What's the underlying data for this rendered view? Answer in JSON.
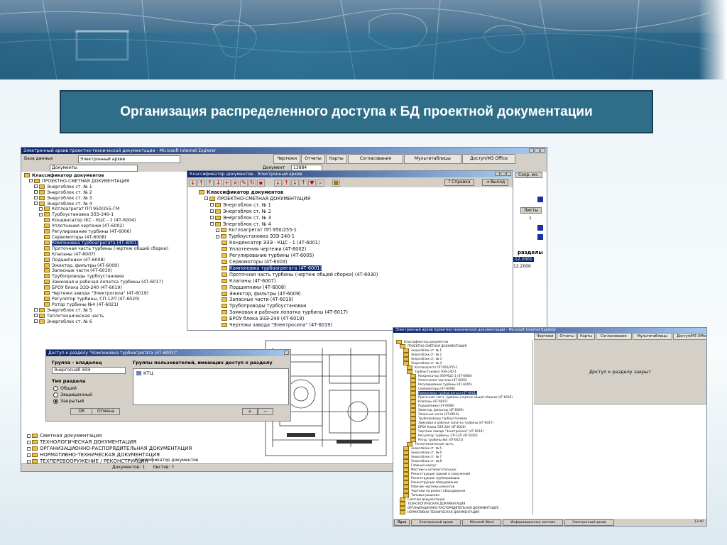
{
  "slide": {
    "title": "Организация распределенного доступа к БД проектной документации"
  },
  "win1": {
    "title": "Электронный архив проектно-технической документации - Microsoft Internet Explorer",
    "base_label": "База данных",
    "base_value": "Электронный архив",
    "tabs": [
      "Чертежи",
      "Отчеты",
      "Карты",
      "Согласования",
      "Мультитаблицы",
      "Доступ/МЗ Office"
    ],
    "doc_label": "Документ",
    "doc_value": "Документы",
    "doc_num": "13884",
    "tree_root": "Классификатор документов",
    "tree": [
      {
        "t": "ПРОЕКТНО-СМЕТНАЯ ДОКУМЕНТАЦИЯ",
        "l": 1
      },
      {
        "t": "Энергоблок ст. № 1",
        "l": 2
      },
      {
        "t": "Энергоблок ст. № 2",
        "l": 2
      },
      {
        "t": "Энергоблок ст. № 3",
        "l": 2
      },
      {
        "t": "Энергоблок ст. № 4",
        "l": 2
      },
      {
        "t": "Котлоагрегат ПП 950/255-ГМ",
        "l": 3
      },
      {
        "t": "Турбоустановка ЭЗЭ-240-1",
        "l": 3
      },
      {
        "t": "Конденсатор (КС - КЦС - 1 (4Т-6004)",
        "l": 4
      },
      {
        "t": "Уплотнения чертежи (4Т-6002)",
        "l": 4
      },
      {
        "t": "Регулирование турбины (4Т-6006)",
        "l": 4
      },
      {
        "t": "Сервомоторы (4Т-6008)",
        "l": 4
      },
      {
        "t": "Компоновка турбоагрегата (4Т-6001)",
        "l": 4,
        "sel": true
      },
      {
        "t": "Проточная часть турбины (чертеж общий сборки)",
        "l": 4
      },
      {
        "t": "Клапаны (4Т-6007)",
        "l": 4
      },
      {
        "t": "Подшипники (4Т-6008)",
        "l": 4
      },
      {
        "t": "Эжектор, фильтры (4Т-6009)",
        "l": 4
      },
      {
        "t": "Запасные части (4Т-6010)",
        "l": 4
      },
      {
        "t": "Трубопроводы турбоустановки",
        "l": 4
      },
      {
        "t": "Замковая и рабочая лопатка турбины (4Т-6017)",
        "l": 4
      },
      {
        "t": "БРОУ блока ЭЗЭ-240 (4Т-6019)",
        "l": 4
      },
      {
        "t": "Чертежи завода \"Электросила\" (4Т-6019)",
        "l": 4
      },
      {
        "t": "Регулятор турбины, СП-12П (4Т-6020)",
        "l": 4
      },
      {
        "t": "Ротор турбины №4 (4Т-6021)",
        "l": 4
      },
      {
        "t": "Энергоблок ст. № 5",
        "l": 2
      },
      {
        "t": "Теплотехническая часть",
        "l": 2
      },
      {
        "t": "Энергоблок ст. № 6",
        "l": 2
      }
    ],
    "tree_bottom": [
      "Сметная документация",
      "ТЕХНОЛОГИЧЕСКАЯ ДОКУМЕНТАЦИЯ",
      "ОРГАНИЗАЦИОННО-РАСПОРЯДИТЕЛЬНАЯ ДОКУМЕНТАЦИЯ",
      "НОРМАТИВНО-ТЕХНИЧЕСКАЯ ДОКУМЕНТАЦИЯ",
      "ТЕХПЕРЕВООРУЖЕНИЕ / РЕКОНСТРУКЦИЯ"
    ],
    "status_left": "Документов: 1",
    "status_right": "Листов: 7",
    "status_mid": "Классификатор документов",
    "right_panel": {
      "search_label": "Сохр. ин.",
      "list_label": "Листы",
      "sheet_num": "1",
      "section_label": "разделы",
      "date1": "12.2001",
      "date2": "12.2000"
    }
  },
  "win2": {
    "title": "Классификатор документов - Электронный архив",
    "tb_help": "Справка",
    "tb_exit": "Выход",
    "tree_root": "Классификатор документов",
    "tree": [
      {
        "t": "ПРОЕКТНО-СМЕТНАЯ ДОКУМЕНТАЦИЯ",
        "l": 1
      },
      {
        "t": "Энергоблок ст. № 1",
        "l": 2
      },
      {
        "t": "Энергоблок ст. № 2",
        "l": 2
      },
      {
        "t": "Энергоблок ст. № 3",
        "l": 2
      },
      {
        "t": "Энергоблок ст. № 4",
        "l": 2
      },
      {
        "t": "Котлоагрегат ПП 950/255-1",
        "l": 3
      },
      {
        "t": "Турбоустановка ЭЗЭ-240-1",
        "l": 3
      },
      {
        "t": "Конденсатор ЭЗЭ - КЦС - 1 (4Т-6001)",
        "l": 4
      },
      {
        "t": "Уплотнения чертежи (4Т-6002)",
        "l": 4
      },
      {
        "t": "Регулирование турбины (4Т-6005)",
        "l": 4
      },
      {
        "t": "Сервомоторы (4Т-6003)",
        "l": 4
      },
      {
        "t": "Компоновка турбоагрегата (4Т-6001)",
        "l": 4,
        "sel": true
      },
      {
        "t": "Проточная часть турбины (чертеж общей сборки) (4Т-6030)",
        "l": 4
      },
      {
        "t": "Клапаны (4Т-6007)",
        "l": 4
      },
      {
        "t": "Подшипники (4Т-6008)",
        "l": 4
      },
      {
        "t": "Эжектор, фильтры (4Т-6009)",
        "l": 4
      },
      {
        "t": "Запасные части (4Т-6010)",
        "l": 4
      },
      {
        "t": "Трубопроводы турбоустановки",
        "l": 4
      },
      {
        "t": "Замковая и рабочая лопатка турбины (4Т-6017)",
        "l": 4
      },
      {
        "t": "БРОУ блока ЭЗЭ-240 (4Т-6018)",
        "l": 4
      },
      {
        "t": "Чертежи завода \"Электросила\" (4Т-6019)",
        "l": 4
      }
    ]
  },
  "dialog": {
    "title": "Доступ к разделу \"Компоновка турбоагрегата (4Т-6001)\"",
    "group_owner_label": "Группа - владелец",
    "group_owner_value": "Энергоснаб ЭЗЭ",
    "section_type_label": "Тип раздела",
    "radio": [
      "Общий",
      "Защищенный",
      "Закрытый"
    ],
    "radio_selected": 2,
    "groups_label": "Группы пользователей, имеющих доступ к разделу",
    "group_item": "КТЦ",
    "ok": "ОК",
    "cancel": "Отмена",
    "plus": "+",
    "minus": "−"
  },
  "win3": {
    "title": "Электронный архив проектно-технической документации - Microsoft Internet Explorer",
    "tabs": [
      "Чертежи",
      "Отчеты",
      "Карты",
      "Согласования",
      "Мультитаблицы",
      "Доступ/МЗ Office"
    ],
    "message": "Доступ к разделу закрыт",
    "tree": [
      {
        "t": "Классификатор документов",
        "l": 0
      },
      {
        "t": "ПРОЕКТНО-СМЕТНАЯ ДОКУМЕНТАЦИЯ",
        "l": 1
      },
      {
        "t": "Энергоблок ст. № 1",
        "l": 2
      },
      {
        "t": "Энергоблок ст. № 2",
        "l": 2
      },
      {
        "t": "Энергоблок ст. № 3",
        "l": 2
      },
      {
        "t": "Энергоблок ст. № 4",
        "l": 2
      },
      {
        "t": "Котлоагрегат ПП 950/255-1",
        "l": 3
      },
      {
        "t": "Турбоустановка ЭЗЭ-240-1",
        "l": 3
      },
      {
        "t": "Конденсатор ЭЗЭ-КЦС-1 (4Т-6004)",
        "l": 4
      },
      {
        "t": "Уплотнения чертежи (4Т-6002)",
        "l": 4
      },
      {
        "t": "Регулирование турбины (4Т-6005)",
        "l": 4
      },
      {
        "t": "Сервомоторы (4Т-6006)",
        "l": 4
      },
      {
        "t": "Компоновка турбоагрегата (4Т-6001)",
        "l": 4,
        "sel": true
      },
      {
        "t": "Проточная часть турбины (чертеж общей сборки) (4Т-6030)",
        "l": 4
      },
      {
        "t": "Клапаны (4Т-6007)",
        "l": 4
      },
      {
        "t": "Подшипники (4Т-6008)",
        "l": 4
      },
      {
        "t": "Эжектор, фильтры (4Т-6009)",
        "l": 4
      },
      {
        "t": "Запасные части (4Т-6010)",
        "l": 4
      },
      {
        "t": "Трубопроводы турбоустановки",
        "l": 4
      },
      {
        "t": "Замковая и рабочая лопатка турбины (4Т-6017)",
        "l": 4
      },
      {
        "t": "БРОУ блока ЭЗЭ-240 (4Т-6018)",
        "l": 4
      },
      {
        "t": "Чертежи завода \"Электросила\" (4Т-6019)",
        "l": 4
      },
      {
        "t": "Регулятор турбины, СП-12П (4Т-6020)",
        "l": 4
      },
      {
        "t": "Ротор турбины №4 (4Т-6021)",
        "l": 4
      },
      {
        "t": "Теплотехническая часть",
        "l": 3
      },
      {
        "t": "Энергоблок ст. № 5",
        "l": 2
      },
      {
        "t": "Энергоблок ст. № 6",
        "l": 2
      },
      {
        "t": "Энергоблок ст. № 7",
        "l": 2
      },
      {
        "t": "Энергоблок ст. № 8",
        "l": 2
      },
      {
        "t": "Главный корпус",
        "l": 2
      },
      {
        "t": "Мостики и вспомогательные",
        "l": 2
      },
      {
        "t": "Реконструкция зданий и сооружений",
        "l": 2
      },
      {
        "t": "Реконструкция трубопроводов",
        "l": 2
      },
      {
        "t": "Реконструкция оборудования",
        "l": 2
      },
      {
        "t": "Рабочие чертежи ремонтов",
        "l": 2
      },
      {
        "t": "Чертежи на ремонт оборудования",
        "l": 2
      },
      {
        "t": "Типовые решения",
        "l": 2
      },
      {
        "t": "Сметная документация",
        "l": 1
      },
      {
        "t": "ТЕХНОЛОГИЧЕСКАЯ ДОКУМЕНТАЦИЯ",
        "l": 1
      },
      {
        "t": "ОРГАНИЗАЦИОННО-РАСПОРЯДИТЕЛЬНАЯ ДОКУМЕНТАЦИЯ",
        "l": 1
      },
      {
        "t": "НОРМАТИВНО-ТЕХНИЧЕСКАЯ ДОКУМЕНТАЦИЯ",
        "l": 1
      },
      {
        "t": "ТЕХПЕРЕВООРУЖЕНИЕ / РЕКОНСТРУКЦИЯ",
        "l": 1
      }
    ],
    "taskbar": [
      "Пуск",
      "Электронный архив",
      "Microsoft Word",
      "Информационная система",
      "Электронный архив"
    ],
    "clock": "13:40"
  },
  "colors": {
    "title_box_bg": "#2f6d88",
    "selection": "#0a246a",
    "folder": "#e6c24a"
  }
}
